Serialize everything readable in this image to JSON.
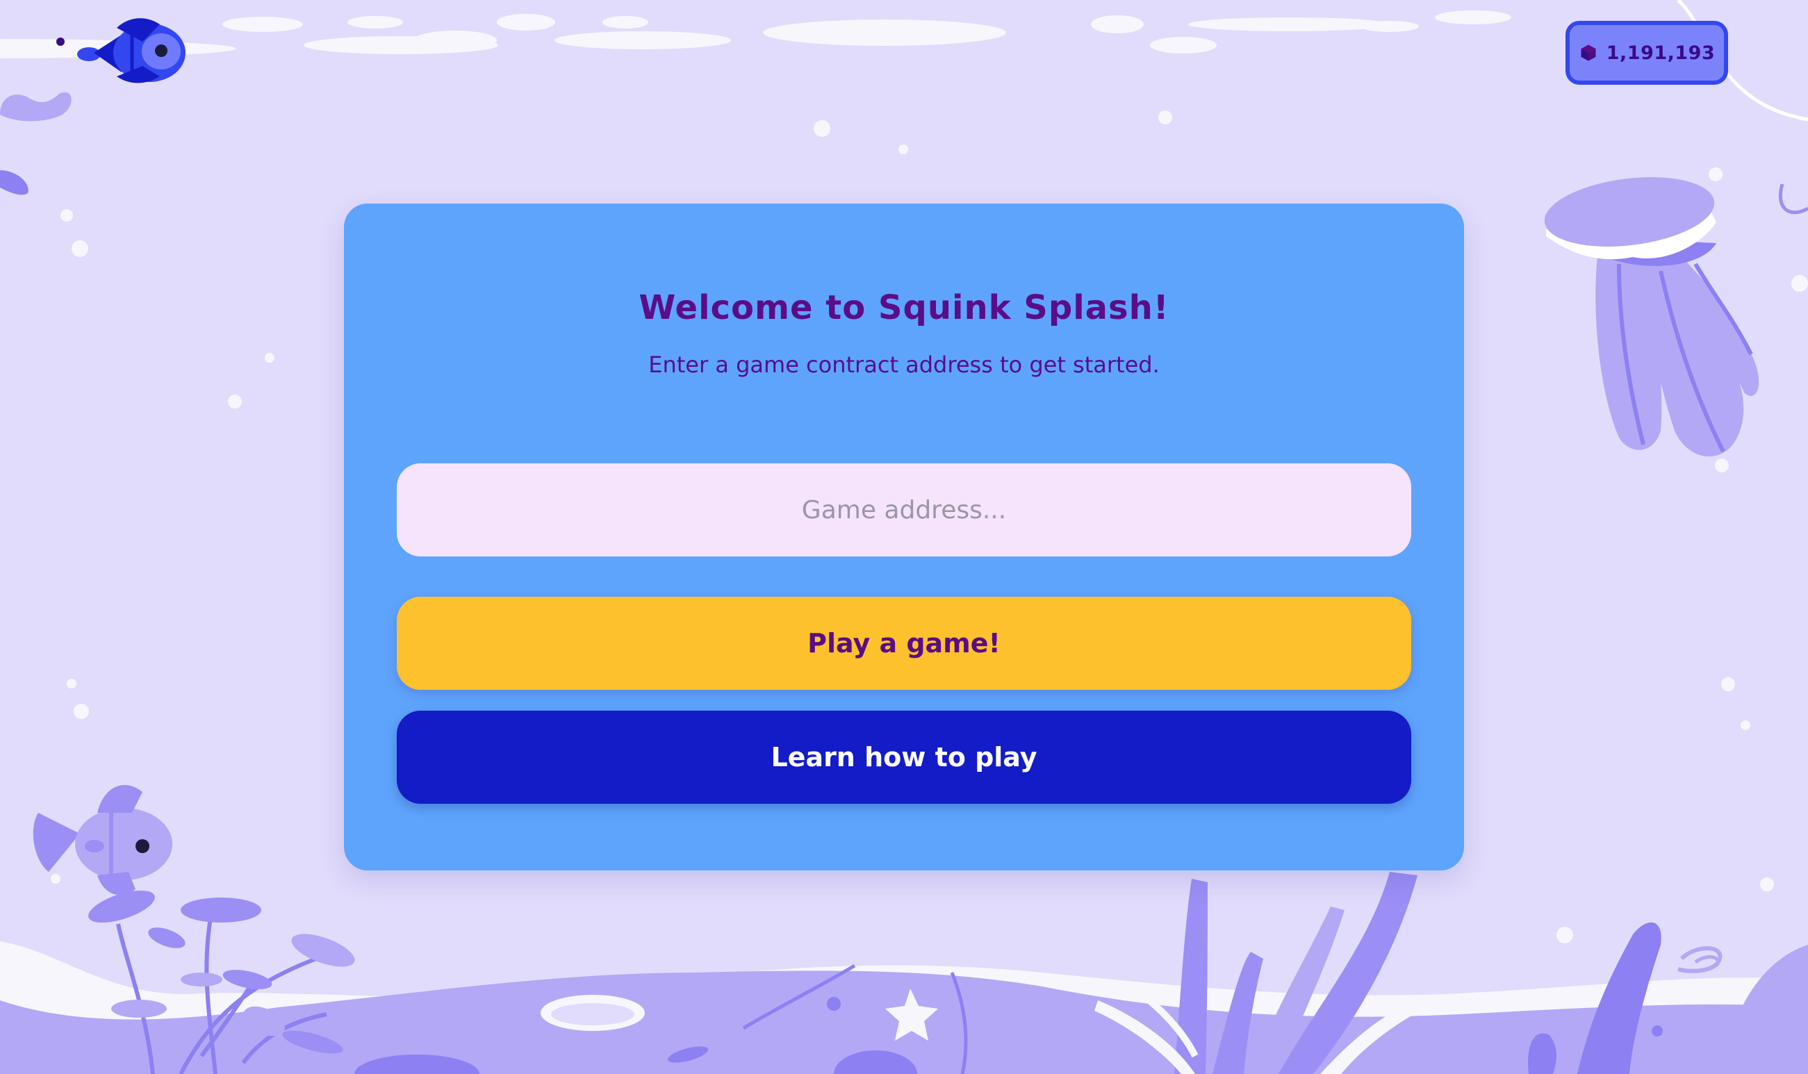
{
  "header": {
    "balance": "1,191,193",
    "balance_icon": "cube-icon"
  },
  "card": {
    "title": "Welcome to Squink Splash!",
    "subtitle": "Enter a game contract address to get started.",
    "address_input": {
      "placeholder": "Game address...",
      "value": ""
    },
    "play_button_label": "Play a game!",
    "learn_button_label": "Learn how to play"
  },
  "theme": {
    "background": "#e1dcfb",
    "card": "#5ea4fd",
    "input_bg": "#f6e4fc",
    "primary_button": "#fec12e",
    "secondary_button": "#131cc7",
    "title_text": "#5a0d87",
    "decoration": "#9b8ef5"
  }
}
